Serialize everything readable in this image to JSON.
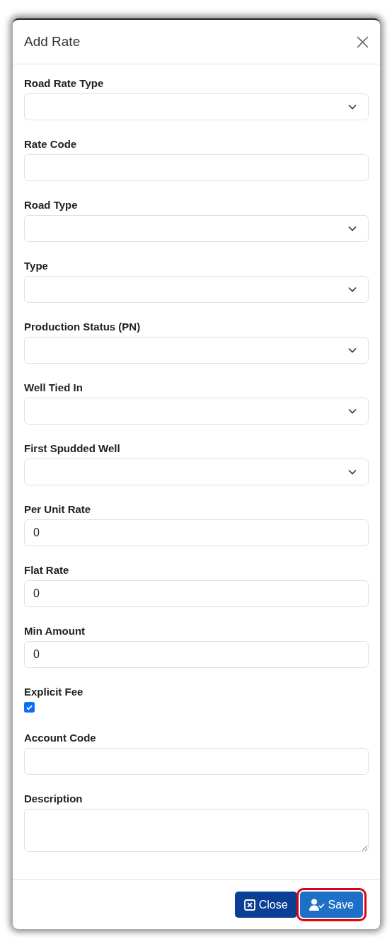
{
  "dialog": {
    "title": "Add Rate"
  },
  "fields": [
    {
      "kind": "select",
      "label": "Road Rate Type"
    },
    {
      "kind": "text",
      "label": "Rate Code"
    },
    {
      "kind": "select",
      "label": "Road Type"
    },
    {
      "kind": "select",
      "label": "Type"
    },
    {
      "kind": "select",
      "label": "Production Status (PN)"
    },
    {
      "kind": "select",
      "label": "Well Tied In"
    },
    {
      "kind": "select",
      "label": "First Spudded Well"
    },
    {
      "kind": "text",
      "label": "Per Unit Rate",
      "value": "0"
    },
    {
      "kind": "text",
      "label": "Flat Rate",
      "value": "0"
    },
    {
      "kind": "text",
      "label": "Min Amount",
      "value": "0"
    },
    {
      "kind": "checkbox",
      "label": "Explicit Fee",
      "checked": true
    },
    {
      "kind": "text",
      "label": "Account Code"
    },
    {
      "kind": "textarea",
      "label": "Description"
    }
  ],
  "buttons": [
    {
      "kind": "close",
      "label": "Close",
      "highlighted": false
    },
    {
      "kind": "save",
      "label": "Save",
      "highlighted": true
    }
  ]
}
